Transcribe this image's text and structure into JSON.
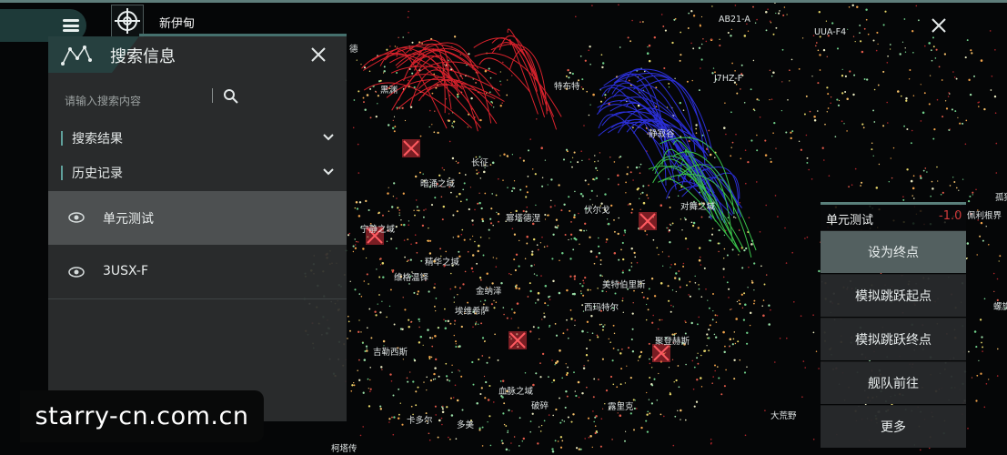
{
  "header": {
    "system_name": "新伊甸",
    "menu_icon": "hamburger-menu-icon",
    "target_icon": "crosshair-target-icon",
    "close_icon": "close-icon"
  },
  "map": {
    "systems": [
      {
        "name": "AB21-A"
      },
      {
        "name": "UUA-F4"
      },
      {
        "name": "J7HZ-F"
      },
      {
        "name": "特布特"
      },
      {
        "name": "黑渊"
      },
      {
        "name": "静寂谷"
      },
      {
        "name": "长征"
      },
      {
        "name": "暗涌之域"
      },
      {
        "name": "对舞之域"
      },
      {
        "name": "佩利根界"
      },
      {
        "name": "宁静之域"
      },
      {
        "name": "幂塔德涅"
      },
      {
        "name": "伏尔戈"
      },
      {
        "name": "精华之域"
      },
      {
        "name": "维格温铎"
      },
      {
        "name": "金纳泽"
      },
      {
        "name": "埃维希萨"
      },
      {
        "name": "美特伯里斯"
      },
      {
        "name": "西玛特尔"
      },
      {
        "name": "吉勒西斯"
      },
      {
        "name": "聚登赫斯"
      },
      {
        "name": "血脉之域"
      },
      {
        "name": "破碎"
      },
      {
        "name": "卡多尔"
      },
      {
        "name": "多美"
      },
      {
        "name": "露里克"
      },
      {
        "name": "大荒野"
      },
      {
        "name": "螺旋"
      },
      {
        "name": "孤独"
      },
      {
        "name": "德"
      },
      {
        "name": "柯塔传"
      }
    ],
    "colors": {
      "background": "#050607",
      "red_route": "#d8222c",
      "blue_route": "#2b2fd6",
      "green_route": "#39c24a",
      "marker": "#d8323a"
    }
  },
  "search_panel": {
    "title": "搜索信息",
    "title_icon": "constellation-icon",
    "close_icon": "close-icon",
    "search_placeholder": "请输入搜索内容",
    "search_icon": "search-icon",
    "sections": [
      {
        "label": "搜索结果",
        "icon": "chevron-down-icon"
      },
      {
        "label": "历史记录",
        "icon": "chevron-down-icon"
      }
    ],
    "history": [
      {
        "label": "单元测试",
        "icon": "eye-icon",
        "active": true
      },
      {
        "label": "3USX-F",
        "icon": "eye-icon",
        "active": false
      }
    ]
  },
  "context_menu": {
    "title": "单元测试",
    "security": "-1.0",
    "items": [
      {
        "label": "设为终点",
        "primary": true
      },
      {
        "label": "模拟跳跃起点",
        "primary": false
      },
      {
        "label": "模拟跳跃终点",
        "primary": false
      },
      {
        "label": "舰队前往",
        "primary": false
      },
      {
        "label": "更多",
        "primary": false
      }
    ]
  },
  "watermark": {
    "text": "starry-cn.com.cn"
  }
}
